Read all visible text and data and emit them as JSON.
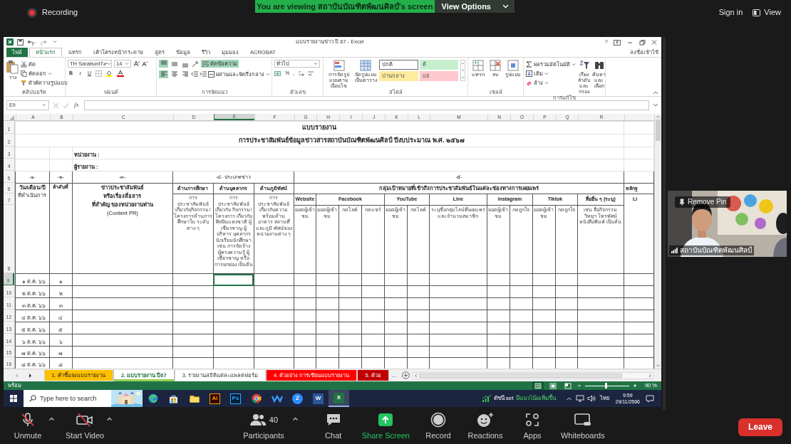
{
  "meeting_bar": {
    "recording": "Recording",
    "banner": "You are viewing สถาบันบัณฑิตพัฒนศิลป์'s screen",
    "view_options": "View Options",
    "sign_in": "Sign in",
    "view": "View"
  },
  "excel": {
    "title": "แบบรายงานข่าว ปี 67 - Excel",
    "help": "?",
    "tabs": [
      {
        "label": "ไฟล์",
        "kind": "file",
        "selected": false
      },
      {
        "label": "หน้าแรก",
        "kind": "tab",
        "selected": true
      },
      {
        "label": "แทรก",
        "kind": "tab",
        "selected": false
      },
      {
        "label": "เค้าโครงหน้ากระดาษ",
        "kind": "tab",
        "selected": false
      },
      {
        "label": "สูตร",
        "kind": "tab",
        "selected": false
      },
      {
        "label": "ข้อมูล",
        "kind": "tab",
        "selected": false
      },
      {
        "label": "รีวิว",
        "kind": "tab",
        "selected": false
      },
      {
        "label": "มุมมอง",
        "kind": "tab",
        "selected": false
      },
      {
        "label": "ACROBAT",
        "kind": "tab",
        "selected": false
      }
    ],
    "account": "ลงชื่อเข้าใช้",
    "ribbon": {
      "clipboard": {
        "paste": "วาง",
        "cut": "ตัด",
        "copy": "คัดลอก",
        "painter": "ตัวคัดวางรูปแบบ",
        "group": "คลิปบอร์ด"
      },
      "font": {
        "name": "TH SarabunIT๙",
        "size": "14",
        "bold": "B",
        "italic": "I",
        "underline": "U",
        "group": "ฟอนต์"
      },
      "alignment": {
        "buttons": [
          {
            "kind": "top",
            "on": true
          },
          {
            "kind": "middle",
            "on": false
          },
          {
            "kind": "bottom",
            "on": false
          },
          {
            "kind": "left",
            "on": true
          },
          {
            "kind": "center",
            "on": false
          },
          {
            "kind": "right",
            "on": false
          }
        ],
        "wrap": {
          "label": "ตัดข้อความ",
          "on": true
        },
        "merge": "ผสานและจัดกึ่งกลาง",
        "group": "การจัดแนว"
      },
      "number": {
        "format": "ทั่วไป",
        "percent": "%",
        "comma": ",",
        "group": "ตัวเลข"
      },
      "styles": {
        "conditional": "การจัดรูปแบบตามเงื่อนไข",
        "as_table": "จัดรูปแบบเป็นตาราง",
        "gallery": [
          {
            "label": "ปกติ",
            "color": "#ffffff",
            "selected": true
          },
          {
            "label": "ดี",
            "color": "#c6efce",
            "selected": false
          },
          {
            "label": "ปานกลาง",
            "color": "#ffeb9c",
            "selected": false
          },
          {
            "label": "แย่",
            "color": "#ffc7ce",
            "selected": false
          }
        ],
        "group": "สไตล์"
      },
      "cells": {
        "insert": "แทรก",
        "delete": "ลบ",
        "format": "รูปแบบ",
        "group": "เซลล์"
      },
      "editing": {
        "autosum": "ผลรวมอัตโนมัติ",
        "fill": "เติม",
        "clear": "ล้าง",
        "sort": "เรียงลำดับและกรอง",
        "find": "ค้นหาและเลือก",
        "group": "การแก้ไข"
      }
    },
    "formula_bar": {
      "name_box": "E9",
      "function_label": "fx"
    },
    "columns": [
      {
        "label": "A",
        "selected": false
      },
      {
        "label": "B",
        "selected": false
      },
      {
        "label": "C",
        "selected": false
      },
      {
        "label": "D",
        "selected": false
      },
      {
        "label": "E",
        "selected": true
      },
      {
        "label": "F",
        "selected": false
      },
      {
        "label": "G",
        "selected": false
      },
      {
        "label": "H",
        "selected": false
      },
      {
        "label": "I",
        "selected": false
      },
      {
        "label": "J",
        "selected": false
      },
      {
        "label": "K",
        "selected": false
      },
      {
        "label": "L",
        "selected": false
      },
      {
        "label": "M",
        "selected": false
      },
      {
        "label": "N",
        "selected": false
      },
      {
        "label": "O",
        "selected": false
      },
      {
        "label": "P",
        "selected": false
      },
      {
        "label": "Q",
        "selected": false
      },
      {
        "label": "R",
        "selected": false
      }
    ],
    "rows": [
      {
        "label": "1",
        "selected": false
      },
      {
        "label": "2",
        "selected": false
      },
      {
        "label": "3",
        "selected": false
      },
      {
        "label": "4",
        "selected": false
      },
      {
        "label": "5",
        "selected": false
      },
      {
        "label": "6",
        "selected": false
      },
      {
        "label": "7",
        "selected": false
      },
      {
        "label": "8",
        "selected": false
      },
      {
        "label": "9",
        "selected": true
      },
      {
        "label": "10",
        "selected": false
      },
      {
        "label": "11",
        "selected": false
      },
      {
        "label": "12",
        "selected": false
      },
      {
        "label": "13",
        "selected": false
      },
      {
        "label": "14",
        "selected": false
      },
      {
        "label": "15",
        "selected": false
      },
      {
        "label": "16",
        "selected": false
      }
    ],
    "sheet": {
      "title": "แบบรายงาน",
      "subtitle": "การประชาสัมพันธ์ข้อมูลข่าวสารสถาบันบัณฑิตพัฒนศิลป์ ปีงบประมาณ พ.ศ. ๒๕๖๗",
      "unit_label": "หน่วยงาน :",
      "reporter_label": "ผู้รายงาน :",
      "section_numbers": [
        "-๑-",
        "-๒-",
        "-๓-",
        "-๔- ประเภทข่าว",
        "-๕-"
      ],
      "date_header": "วัน/เดือน/ปี",
      "date_subheader": "ที่ดำเนินการ",
      "seq_header": "ลำดับที่",
      "content_header": [
        "ข่าวประชาสัมพันธ์",
        "หรือเรื่องสื่อสาร",
        "ที่สำคัญ ของหน่วยงานท่าน",
        "(Content PR)"
      ],
      "news_types": [
        {
          "title": "ด้านการศึกษา",
          "description": "การประชาสัมพันธ์ เกี่ยวกับกิจกรรม/ โครงการด้านการศึกษาใน ระดับต่าง ๆ"
        },
        {
          "title": "ด้านบุคลากร",
          "description": "การประชาสัมพันธ์เกี่ยวกับ กิจกรรม/โครงการ เกี่ยวกับศิลปินแห่งชาติ ผู้เชี่ยวชาญ ผู้บริหาร บุคลากร นักเรียนนักศึกษา เช่น การจัดจ้างผู้ทรงความรู้ ผู้เชี่ยวชาญ หรือการยกย่อง เป็นต้น"
        },
        {
          "title": "ด้านภูมิทัศน์",
          "description": "การประชาสัมพันธ์ เกี่ยวกับความพร้อมด้าน อาคาร สถานที่และภูมิ ทัศน์ของหน่วยงานต่าง ๆ"
        }
      ],
      "audience_header": "กลุ่มเป้าหมายที่เข้าถึงการประชาสัมพันธ์ในแต่ละช่องทางการเผยแพร่",
      "channels": [
        {
          "name": "Website",
          "metrics": [
            "ยอดผู้เข้าชม"
          ]
        },
        {
          "name": "Facebook",
          "metrics": [
            "ยอดผู้เข้าชม",
            "กดไลค์",
            "กดแชร์"
          ]
        },
        {
          "name": "YouTube",
          "metrics": [
            "ยอดผู้เข้าชม",
            "กดไลค์"
          ]
        },
        {
          "name": "Line",
          "metrics": [
            "ระบุชื่อกลุ่มไลน์ที่เผยแพร่และจำนวนสมาชิก"
          ]
        },
        {
          "name": "Instagram",
          "metrics": [
            "ยอดผู้เข้าชม",
            "กดถูกใจ"
          ]
        },
        {
          "name": "Tiktok",
          "metrics": [
            "ยอดผู้เข้าชม",
            "กดถูกใจ"
          ]
        },
        {
          "name": "สื่ออื่น ๆ (ระบุ)",
          "metrics": [
            "เช่น สื่อกิจกรรม วิทยุฯ โทรทัศน์ หนังสือพิมพ์ เป็นต้น"
          ]
        }
      ],
      "evidence_header": "หลักฐ",
      "evidence_subheader": "Li",
      "data_rows": [
        {
          "date": "๑ ต.ค. ๖๖",
          "seq": "๑"
        },
        {
          "date": "๒ ต.ค. ๖๖",
          "seq": "๒"
        },
        {
          "date": "๓ ต.ค. ๖๖",
          "seq": "๓"
        },
        {
          "date": "๔ ต.ค. ๖๖",
          "seq": "๔"
        },
        {
          "date": "๕ ต.ค. ๖๖",
          "seq": "๕"
        },
        {
          "date": "๖ ต.ค. ๖๖",
          "seq": "๖"
        },
        {
          "date": "๗ ต.ค. ๖๖",
          "seq": "๗"
        },
        {
          "date": "๘ ต.ค. ๖๖",
          "seq": "๘"
        }
      ]
    },
    "sheet_tabs": [
      {
        "label": "1. คำชี้แจงแบบรายงาน",
        "color": "#ffc000",
        "selected": false
      },
      {
        "label": "2. แบบรายงาน ปี67",
        "color": "#92d050",
        "selected": true
      },
      {
        "label": "3. รายงานสถิติแต่ละแพลตฟอร์ม",
        "selected": false
      },
      {
        "label": "4. ตัวอย่าง การเขียนแบบรายงาน",
        "color": "#ff0000",
        "selected": false
      },
      {
        "label": "5. ตัวอ",
        "color": "#c00000",
        "selected": false
      }
    ],
    "more_tabs": "...",
    "status": {
      "ready": "พร้อม",
      "views": [
        {
          "kind": "normal",
          "selected": true
        },
        {
          "kind": "page-layout",
          "selected": false
        },
        {
          "kind": "page-break",
          "selected": false
        }
      ],
      "zoom_slider": {
        "level": 0.48
      },
      "zoom": "90 %"
    }
  },
  "taskbar": {
    "search_placeholder": "Type here to search",
    "apps": [
      {
        "kind": "edge",
        "selected": false
      },
      {
        "kind": "store",
        "selected": false
      },
      {
        "kind": "explorer",
        "selected": false
      },
      {
        "kind": "ai",
        "glyph": "Ai",
        "selected": false
      },
      {
        "kind": "ps",
        "glyph": "Ps",
        "selected": false
      },
      {
        "kind": "chrome",
        "selected": false
      },
      {
        "kind": "meet",
        "selected": false
      },
      {
        "kind": "zoom",
        "glyph": "Z",
        "selected": false
      },
      {
        "kind": "word",
        "glyph": "W",
        "selected": false
      },
      {
        "kind": "excel",
        "glyph": "X",
        "selected": true
      }
    ],
    "stock_name": "ดัชนี set",
    "stock_trend": "มีแนวโน้มเพิ่มขึ้น",
    "language": "ไทย",
    "time": "9:59",
    "date": "29/11/2566"
  },
  "video_tile": {
    "remove_pin": "Remove Pin",
    "name": "สถาบันบัณฑิตพัฒนศิลป์"
  },
  "toolbar": [
    {
      "kind": "mic",
      "label": "Unmute",
      "menu": true
    },
    {
      "kind": "video",
      "label": "Start Video",
      "menu": true
    },
    {
      "kind": "participants",
      "label": "Participants",
      "count": "40",
      "menu": true
    },
    {
      "kind": "chat",
      "label": "Chat",
      "menu": false
    },
    {
      "kind": "share",
      "label": "Share Screen",
      "menu": false
    },
    {
      "kind": "record",
      "label": "Record",
      "menu": false
    },
    {
      "kind": "reactions",
      "label": "Reactions",
      "menu": false
    },
    {
      "kind": "apps",
      "label": "Apps",
      "menu": false
    },
    {
      "kind": "whiteboards",
      "label": "Whiteboards",
      "menu": false
    }
  ],
  "leave": "Leave"
}
